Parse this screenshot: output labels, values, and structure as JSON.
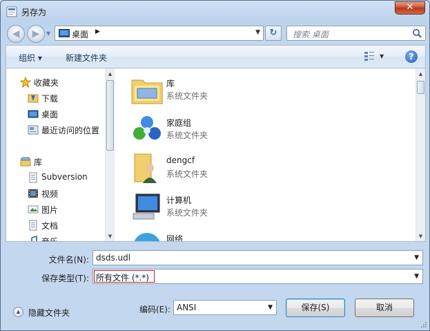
{
  "window": {
    "title": "另存为",
    "close_glyph": "✕"
  },
  "address": {
    "location": "桌面",
    "separator": "▶",
    "dropdown_glyph": "▼",
    "refresh_glyph": "↻"
  },
  "search": {
    "placeholder": "搜索 桌面"
  },
  "toolbar": {
    "organize_label": "组织 ▾",
    "new_folder_label": "新建文件夹",
    "view_drop_glyph": "▼",
    "help_glyph": "?"
  },
  "sidebar": {
    "items": [
      {
        "label": "收藏夹",
        "icon": "star-icon"
      },
      {
        "label": "下载",
        "icon": "download-folder-icon"
      },
      {
        "label": "桌面",
        "icon": "desktop-icon"
      },
      {
        "label": "最近访问的位置",
        "icon": "recent-places-icon"
      },
      {
        "label": "库",
        "icon": "library-icon"
      },
      {
        "label": "Subversion",
        "icon": "document-icon"
      },
      {
        "label": "视频",
        "icon": "video-icon"
      },
      {
        "label": "图片",
        "icon": "picture-icon"
      },
      {
        "label": "文档",
        "icon": "document-icon"
      },
      {
        "label": "音乐",
        "icon": "music-icon"
      }
    ]
  },
  "files": [
    {
      "name": "库",
      "type": "系统文件夹",
      "icon": "library-folder-icon"
    },
    {
      "name": "家庭组",
      "type": "系统文件夹",
      "icon": "homegroup-icon"
    },
    {
      "name": "dengcf",
      "type": "系统文件夹",
      "icon": "user-folder-icon"
    },
    {
      "name": "计算机",
      "type": "系统文件夹",
      "icon": "computer-icon"
    },
    {
      "name": "网络",
      "type": "",
      "icon": "network-icon"
    }
  ],
  "form": {
    "filename_label": "文件名(N):",
    "filename_value": "dsds.udl",
    "filetype_label": "保存类型(T):",
    "filetype_value": "所有文件  (*.*)",
    "encoding_label": "编码(E):",
    "encoding_value": "ANSI",
    "dropdown_glyph": "▼"
  },
  "footer": {
    "hide_folders_label": "隐藏文件夹",
    "hide_folders_glyph": "▲",
    "save_label": "保存(S)",
    "cancel_label": "取消"
  },
  "colors": {
    "accent": "#1f5fb0",
    "highlight_border": "#d02020"
  }
}
